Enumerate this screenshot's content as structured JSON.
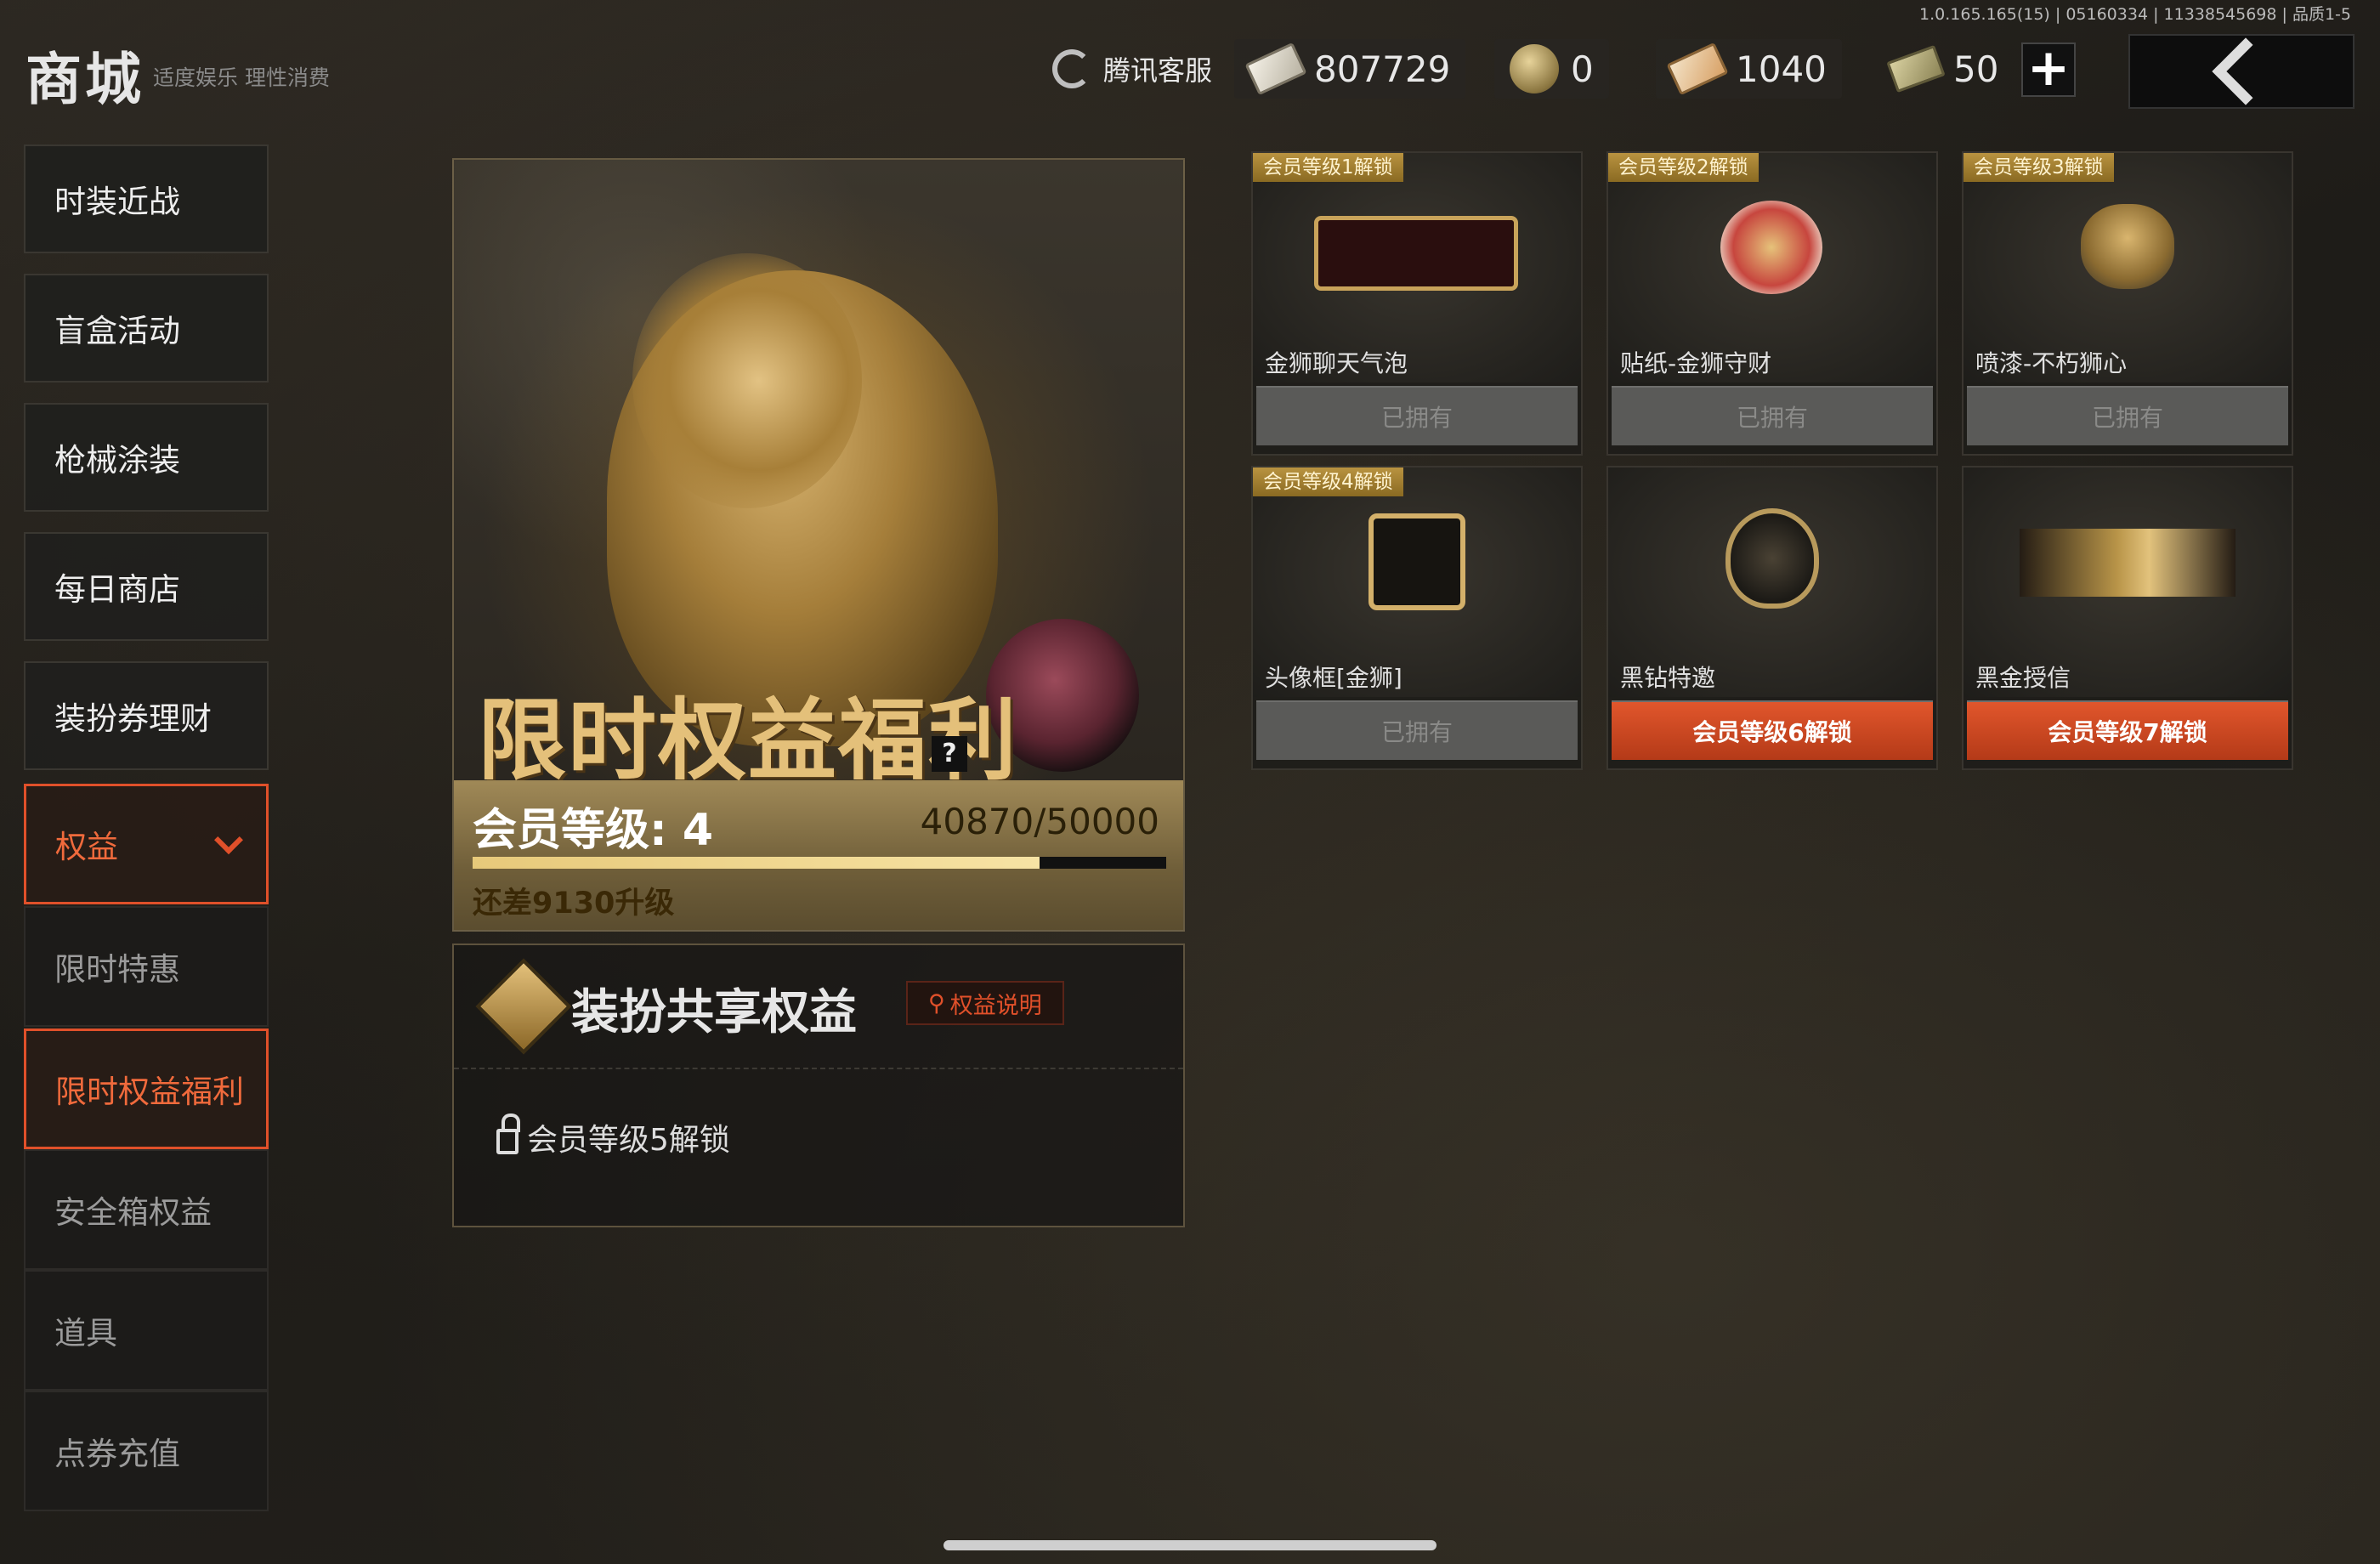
{
  "version": "1.0.165.165(15) | 05160334 | 11338545698 | 品质1-5",
  "header": {
    "title": "商城",
    "subtitle": "适度娱乐 理性消费",
    "customer_service": "腾讯客服",
    "currencies": [
      {
        "icon": "ticket-icon",
        "value": "807729"
      },
      {
        "icon": "gold-coin-icon",
        "value": "0"
      },
      {
        "icon": "coupon-icon",
        "value": "1040"
      },
      {
        "icon": "bills-icon",
        "value": "50"
      }
    ]
  },
  "sidebar": {
    "items": [
      {
        "label": "时装近战"
      },
      {
        "label": "盲盒活动"
      },
      {
        "label": "枪械涂装"
      },
      {
        "label": "每日商店"
      },
      {
        "label": "装扮券理财"
      },
      {
        "label": "权益"
      }
    ],
    "sub_items": [
      {
        "label": "限时特惠"
      },
      {
        "label": "限时权益福利"
      },
      {
        "label": "安全箱权益"
      },
      {
        "label": "道具"
      },
      {
        "label": "点券充值"
      }
    ]
  },
  "hero": {
    "title": "限时权益福利",
    "help": "?",
    "level_label": "会员等级: 4",
    "exp_text": "40870/50000",
    "progress": 0.8174,
    "remain_text": "还差9130升级"
  },
  "share": {
    "title": "装扮共享权益",
    "help_label": "权益说明",
    "lock_text": "会员等级5解锁"
  },
  "rewards": [
    {
      "badge": "会员等级1解锁",
      "name": "金狮聊天气泡",
      "button": "已拥有",
      "state": "owned"
    },
    {
      "badge": "会员等级2解锁",
      "name": "贴纸-金狮守财",
      "button": "已拥有",
      "state": "owned"
    },
    {
      "badge": "会员等级3解锁",
      "name": "喷漆-不朽狮心",
      "button": "已拥有",
      "state": "owned"
    },
    {
      "badge": "会员等级4解锁",
      "name": "头像框[金狮]",
      "button": "已拥有",
      "state": "owned"
    },
    {
      "badge": "",
      "name": "黑钻特邀",
      "button": "会员等级6解锁",
      "state": "locked"
    },
    {
      "badge": "",
      "name": "黑金授信",
      "button": "会员等级7解锁",
      "state": "locked"
    }
  ]
}
